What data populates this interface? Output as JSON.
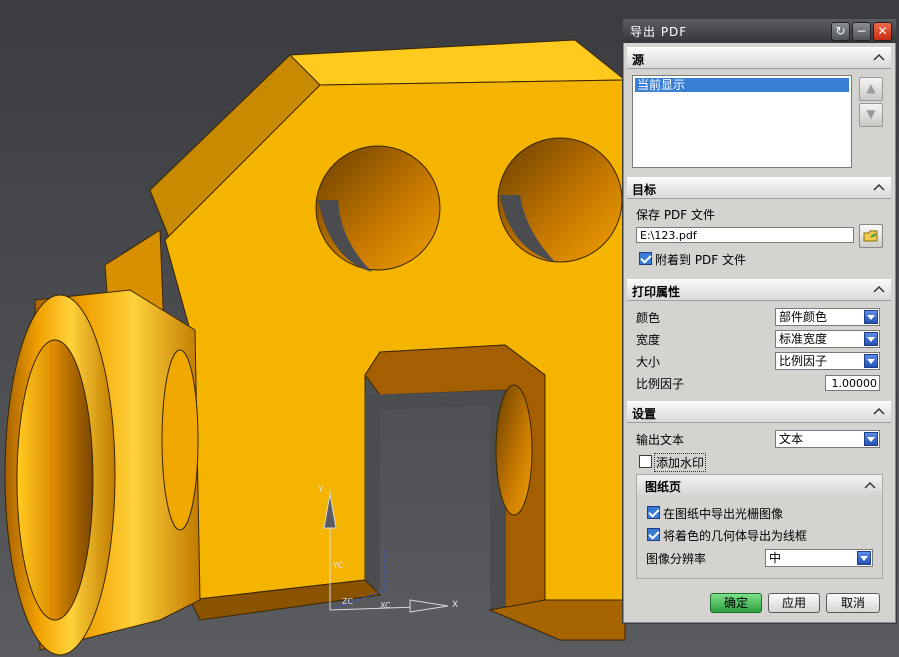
{
  "dialog": {
    "title": "导出 PDF",
    "source_section": {
      "title": "源",
      "list_items": [
        "当前显示"
      ]
    },
    "target_section": {
      "title": "目标",
      "save_label": "保存 PDF 文件",
      "file_path": "E:\\123.pdf",
      "attach_label": "附着到 PDF 文件",
      "attach_checked": true
    },
    "print_section": {
      "title": "打印属性",
      "color_label": "颜色",
      "color_value": "部件颜色",
      "width_label": "宽度",
      "width_value": "标准宽度",
      "size_label": "大小",
      "size_value": "比例因子",
      "scale_label": "比例因子",
      "scale_value": "1.00000"
    },
    "settings_section": {
      "title": "设置",
      "output_text_label": "输出文本",
      "output_text_value": "文本",
      "watermark_label": "添加水印",
      "watermark_checked": false,
      "drawing_sheet": {
        "title": "图纸页",
        "raster_label": "在图纸中导出光栅图像",
        "raster_checked": true,
        "wireframe_label": "将着色的几何体导出为线框",
        "wireframe_checked": true,
        "resolution_label": "图像分辨率",
        "resolution_value": "中"
      }
    },
    "buttons": {
      "ok": "确定",
      "apply": "应用",
      "cancel": "取消"
    }
  },
  "viewport": {
    "axis_labels": {
      "x": "X",
      "y": "Y",
      "xc": "XC",
      "yc": "YC",
      "zc": "ZC"
    },
    "part_color": "#f5b400"
  }
}
